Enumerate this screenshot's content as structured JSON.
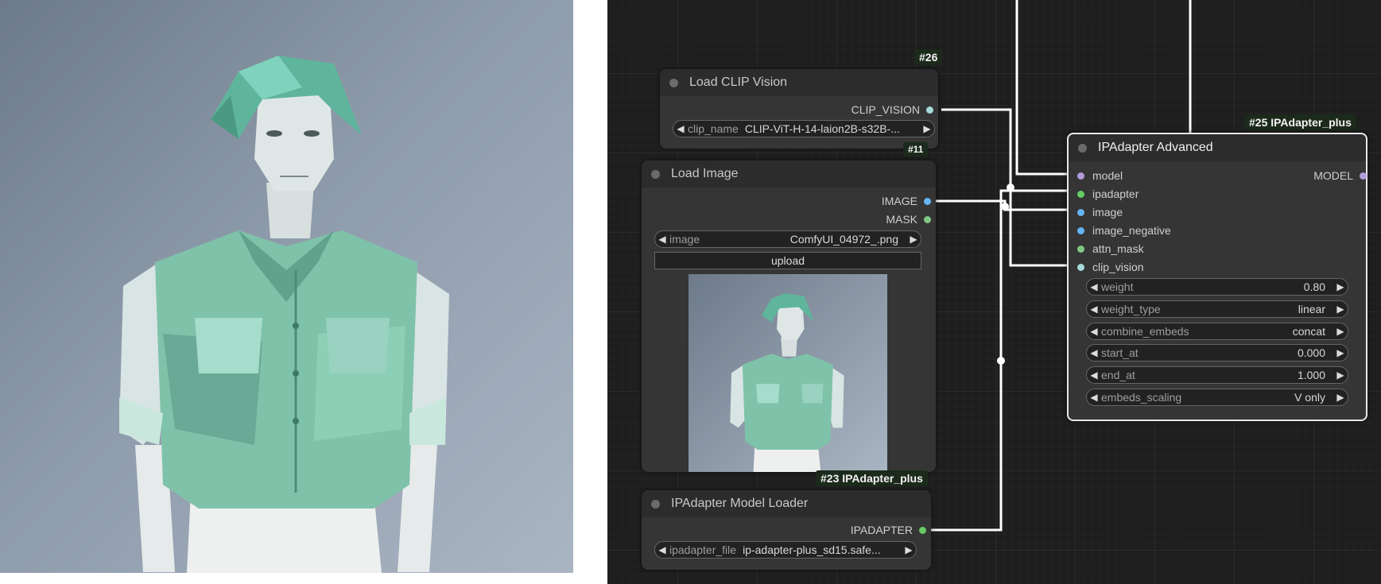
{
  "nodes": {
    "clip_vision": {
      "badge": "#26",
      "title": "Load CLIP Vision",
      "output": "CLIP_VISION",
      "widget": {
        "label": "clip_name",
        "value": "CLIP-ViT-H-14-laion2B-s32B-..."
      }
    },
    "load_image": {
      "badge": "#11",
      "title": "Load Image",
      "outputs": [
        "IMAGE",
        "MASK"
      ],
      "widget": {
        "label": "image",
        "value": "ComfyUI_04972_.png"
      },
      "upload_label": "upload"
    },
    "model_loader": {
      "badge": "#23 IPAdapter_plus",
      "title": "IPAdapter Model Loader",
      "output": "IPADAPTER",
      "widget": {
        "label": "ipadapter_file",
        "value": "ip-adapter-plus_sd15.safe..."
      }
    },
    "advanced": {
      "badge": "#25 IPAdapter_plus",
      "title": "IPAdapter Advanced",
      "output": "MODEL",
      "inputs": [
        "model",
        "ipadapter",
        "image",
        "image_negative",
        "attn_mask",
        "clip_vision"
      ],
      "widgets": [
        {
          "label": "weight",
          "value": "0.80"
        },
        {
          "label": "weight_type",
          "value": "linear"
        },
        {
          "label": "combine_embeds",
          "value": "concat"
        },
        {
          "label": "start_at",
          "value": "0.000"
        },
        {
          "label": "end_at",
          "value": "1.000"
        },
        {
          "label": "embeds_scaling",
          "value": "V only"
        }
      ]
    }
  },
  "colors": {
    "model": "#b39ddb",
    "ipadapter": "#66cc66",
    "image": "#64b5f6",
    "mask": "#81c784",
    "clip_vision": "#a8dadc",
    "link": "#ffffff",
    "shirt": "#7fbfa8"
  },
  "icons": [
    "triangle-left-icon",
    "triangle-right-icon",
    "slot-dot-icon"
  ]
}
